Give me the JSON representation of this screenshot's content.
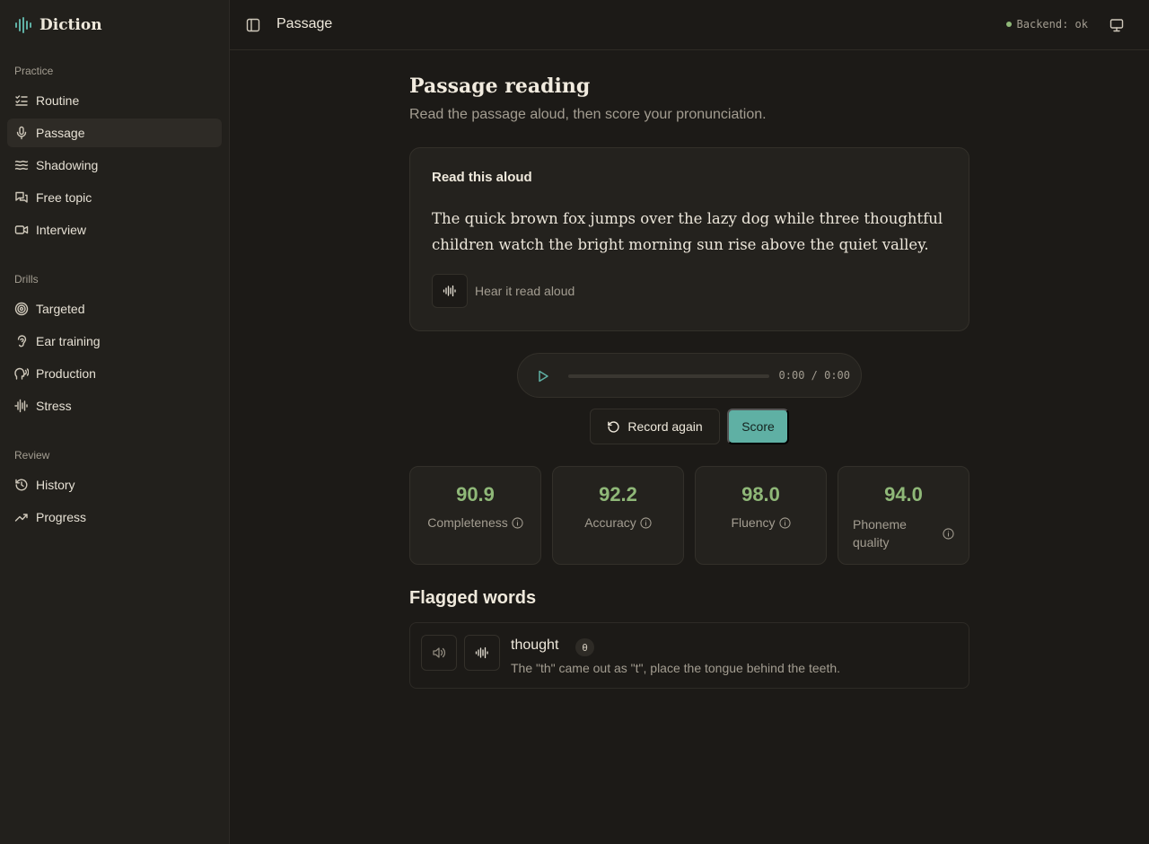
{
  "app": {
    "name": "Diction"
  },
  "sidebar": {
    "groups": [
      {
        "label": "Practice",
        "items": [
          {
            "label": "Routine",
            "icon": "list-checks-icon"
          },
          {
            "label": "Passage",
            "icon": "microphone-icon",
            "active": true
          },
          {
            "label": "Shadowing",
            "icon": "waves-icon"
          },
          {
            "label": "Free topic",
            "icon": "chat-bubbles-icon"
          },
          {
            "label": "Interview",
            "icon": "video-icon"
          }
        ]
      },
      {
        "label": "Drills",
        "items": [
          {
            "label": "Targeted",
            "icon": "target-icon"
          },
          {
            "label": "Ear training",
            "icon": "ear-icon"
          },
          {
            "label": "Production",
            "icon": "speaking-head-icon"
          },
          {
            "label": "Stress",
            "icon": "audio-waveform-icon"
          }
        ]
      },
      {
        "label": "Review",
        "items": [
          {
            "label": "History",
            "icon": "history-icon"
          },
          {
            "label": "Progress",
            "icon": "trending-up-icon"
          }
        ]
      }
    ]
  },
  "header": {
    "breadcrumb": "Passage",
    "status": "Backend: ok"
  },
  "page": {
    "title": "Passage reading",
    "subtitle": "Read the passage aloud, then score your pronunciation."
  },
  "passage_card": {
    "title": "Read this aloud",
    "text": "The quick brown fox jumps over the lazy dog while three thoughtful children watch the bright morning sun rise above the quiet valley.",
    "hear_label": "Hear it read aloud"
  },
  "player": {
    "time": "0:00 / 0:00"
  },
  "actions": {
    "record_again": "Record again",
    "score": "Score"
  },
  "metrics": [
    {
      "value": "90.9",
      "label": "Completeness"
    },
    {
      "value": "92.2",
      "label": "Accuracy"
    },
    {
      "value": "98.0",
      "label": "Fluency"
    },
    {
      "value": "94.0",
      "label": "Phoneme quality"
    }
  ],
  "flagged": {
    "title": "Flagged words",
    "items": [
      {
        "word": "thought",
        "phoneme": "θ",
        "feedback": "The \"th\" came out as \"t\", place the tongue behind the teeth."
      }
    ]
  },
  "colors": {
    "accent": "#5fb0a4",
    "score": "#8fb878",
    "background": "#1c1a17"
  }
}
